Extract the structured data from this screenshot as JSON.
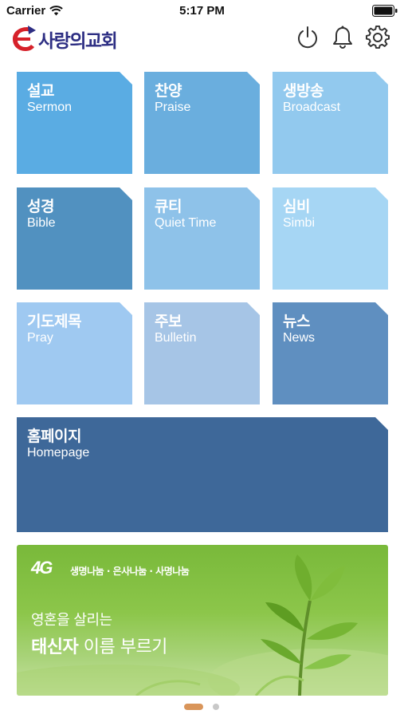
{
  "status_bar": {
    "carrier": "Carrier",
    "time": "5:17 PM"
  },
  "header": {
    "logo_text": "사랑의교회",
    "icons": [
      "power-icon",
      "bell-icon",
      "gear-icon"
    ]
  },
  "tiles": [
    {
      "ko": "설교",
      "en": "Sermon",
      "color": "#5aace3"
    },
    {
      "ko": "찬양",
      "en": "Praise",
      "color": "#6aaede"
    },
    {
      "ko": "생방송",
      "en": "Broadcast",
      "color": "#92c9ee"
    },
    {
      "ko": "성경",
      "en": "Bible",
      "color": "#5191c0"
    },
    {
      "ko": "큐티",
      "en": "Quiet Time",
      "color": "#8ec2e9"
    },
    {
      "ko": "심비",
      "en": "Simbi",
      "color": "#a6d6f4"
    },
    {
      "ko": "기도제목",
      "en": "Pray",
      "color": "#9fc9f1"
    },
    {
      "ko": "주보",
      "en": "Bulletin",
      "color": "#a6c5e6"
    },
    {
      "ko": "뉴스",
      "en": "News",
      "color": "#5f8fc0"
    },
    {
      "ko": "홈페이지",
      "en": "Homepage",
      "color": "#3e6899"
    }
  ],
  "banner": {
    "logo": "4G",
    "tagline": "생명나눔 · 은사나눔 · 사명나눔",
    "line1": "영혼을 살리는",
    "line2_bold": "태신자",
    "line2_rest": " 이름 부르기"
  },
  "pager": {
    "pages": 2,
    "active": 1,
    "active_color": "#d9955a",
    "inactive_color": "#c8c8c8"
  }
}
